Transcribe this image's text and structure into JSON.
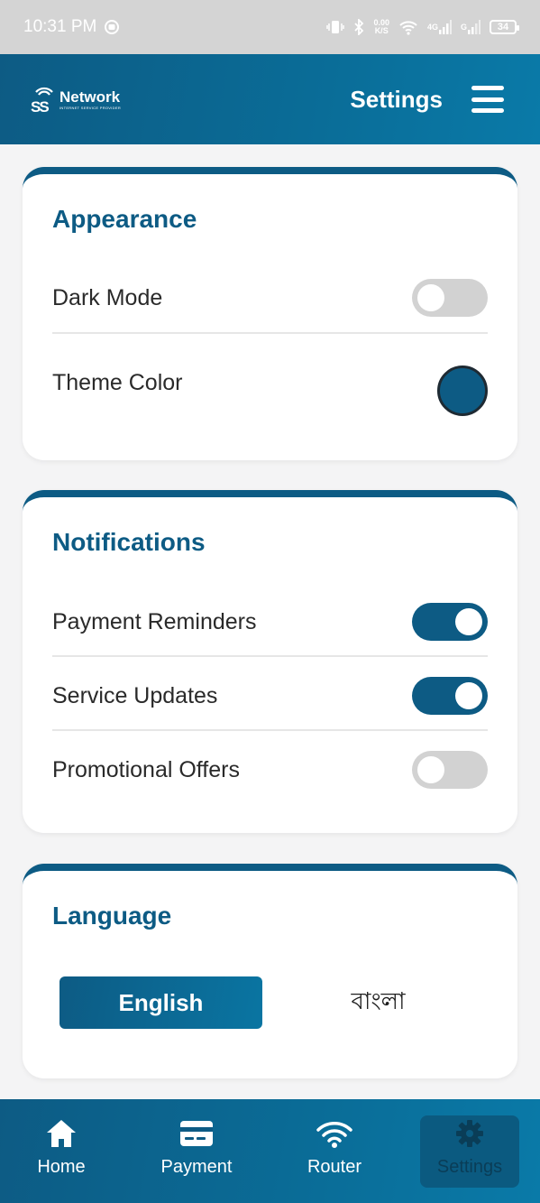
{
  "status_bar": {
    "time": "10:31 PM",
    "speed_top": "0.00",
    "speed_unit": "K/S",
    "net_4g": "4G",
    "net_g": "G",
    "battery": "34"
  },
  "header": {
    "logo_mark": "SS",
    "logo_name": "Network",
    "logo_tagline": "INTERNET SERVICE PROVIDER",
    "title": "Settings"
  },
  "appearance": {
    "title": "Appearance",
    "dark_mode_label": "Dark Mode",
    "dark_mode_on": false,
    "theme_color_label": "Theme Color",
    "theme_color": "#0d5b84"
  },
  "notifications": {
    "title": "Notifications",
    "items": [
      {
        "label": "Payment Reminders",
        "on": true
      },
      {
        "label": "Service Updates",
        "on": true
      },
      {
        "label": "Promotional Offers",
        "on": false
      }
    ]
  },
  "language": {
    "title": "Language",
    "options": [
      "English",
      "বাংলা"
    ],
    "selected": "English"
  },
  "nav": {
    "items": [
      {
        "label": "Home",
        "icon": "home-icon"
      },
      {
        "label": "Payment",
        "icon": "card-icon"
      },
      {
        "label": "Router",
        "icon": "wifi-icon"
      },
      {
        "label": "Settings",
        "icon": "gear-icon"
      }
    ],
    "active": "Settings"
  },
  "colors": {
    "primary": "#0d5b84",
    "toggle_off": "#d2d2d2"
  }
}
